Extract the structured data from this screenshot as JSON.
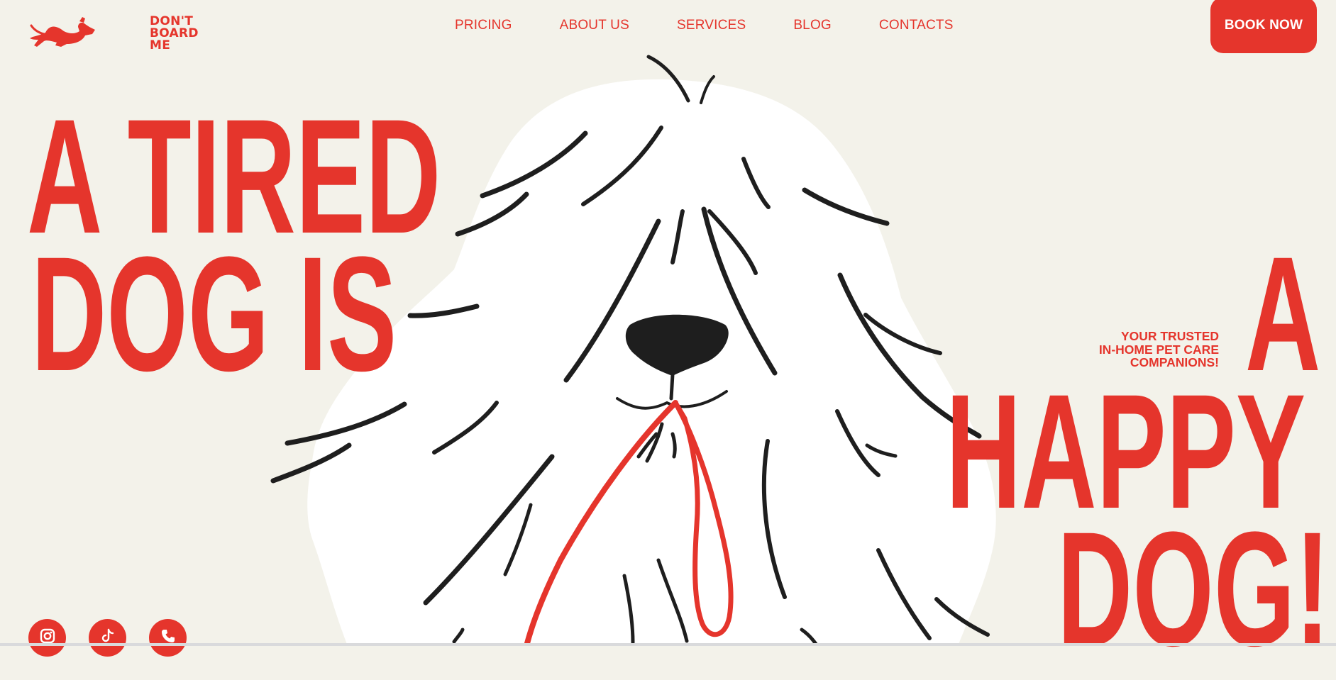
{
  "brand": {
    "logo_lines": [
      "DON'T",
      "BOARD",
      "ME"
    ],
    "logo_icon": "dachshund-icon",
    "accent_color": "#e5352c",
    "background_color": "#f3f2ea"
  },
  "nav": {
    "items": [
      {
        "label": "PRICING"
      },
      {
        "label": "ABOUT US"
      },
      {
        "label": "SERVICES"
      },
      {
        "label": "BLOG"
      },
      {
        "label": "CONTACTS"
      }
    ],
    "cta_label": "BOOK NOW"
  },
  "hero": {
    "headline_left": [
      "A TIRED",
      "DOG IS"
    ],
    "headline_right": [
      "A",
      "HAPPY",
      "DOG!"
    ],
    "tagline": [
      "YOUR TRUSTED",
      "IN-HOME PET CARE",
      "COMPANIONS!"
    ],
    "illustration": "sheepdog-with-leash-illustration"
  },
  "socials": [
    {
      "icon": "instagram-icon"
    },
    {
      "icon": "tiktok-icon"
    },
    {
      "icon": "phone-icon"
    }
  ]
}
